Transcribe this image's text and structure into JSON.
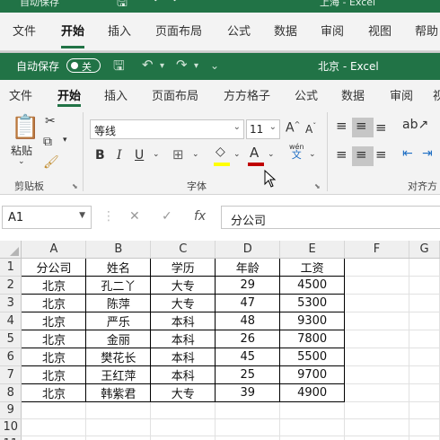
{
  "bg_window": {
    "title_left": "自动保存",
    "title_right": "上海 - Excel",
    "tabs": [
      "文件",
      "开始",
      "插入",
      "页面布局",
      "公式",
      "数据",
      "审阅",
      "视图",
      "帮助"
    ]
  },
  "title_bar": {
    "autosave_label": "自动保存",
    "toggle_label": "关",
    "doc_title": "北京 - Excel"
  },
  "menu": {
    "tabs": [
      "文件",
      "开始",
      "插入",
      "页面布局",
      "方方格子",
      "公式",
      "数据",
      "审阅",
      "视"
    ],
    "active": "开始"
  },
  "ribbon": {
    "paste_label": "粘贴",
    "clipboard_label": "剪贴板",
    "font_label": "字体",
    "align_label": "对齐方",
    "font_name": "等线",
    "font_size": "11",
    "bold": "B",
    "italic": "I",
    "underline": "U",
    "grow_font": "A",
    "shrink_font": "A",
    "font_color": "A",
    "phonetic_top": "wén",
    "phonetic_bottom": "文"
  },
  "formula_bar": {
    "name_box": "A1",
    "fx": "fx",
    "value": "分公司"
  },
  "sheet": {
    "columns": [
      "A",
      "B",
      "C",
      "D",
      "E",
      "F",
      "G"
    ],
    "rows": [
      [
        "分公司",
        "姓名",
        "学历",
        "年龄",
        "工资"
      ],
      [
        "北京",
        "孔二丫",
        "大专",
        "29",
        "4500"
      ],
      [
        "北京",
        "陈萍",
        "大专",
        "47",
        "5300"
      ],
      [
        "北京",
        "严乐",
        "本科",
        "48",
        "9300"
      ],
      [
        "北京",
        "金丽",
        "本科",
        "26",
        "7800"
      ],
      [
        "北京",
        "樊花长",
        "本科",
        "45",
        "5500"
      ],
      [
        "北京",
        "王红萍",
        "本科",
        "25",
        "9700"
      ],
      [
        "北京",
        "韩紫君",
        "大专",
        "39",
        "4900"
      ],
      [
        "",
        "",
        "",
        "",
        ""
      ],
      [
        "",
        "",
        "",
        "",
        ""
      ],
      [
        "",
        "",
        "",
        "",
        ""
      ]
    ]
  },
  "colors": {
    "accent": "#217346",
    "ribbon_bg": "#f3f3f3",
    "font_color_bar": "#c00000",
    "highlight_bar": "#ffff00"
  }
}
